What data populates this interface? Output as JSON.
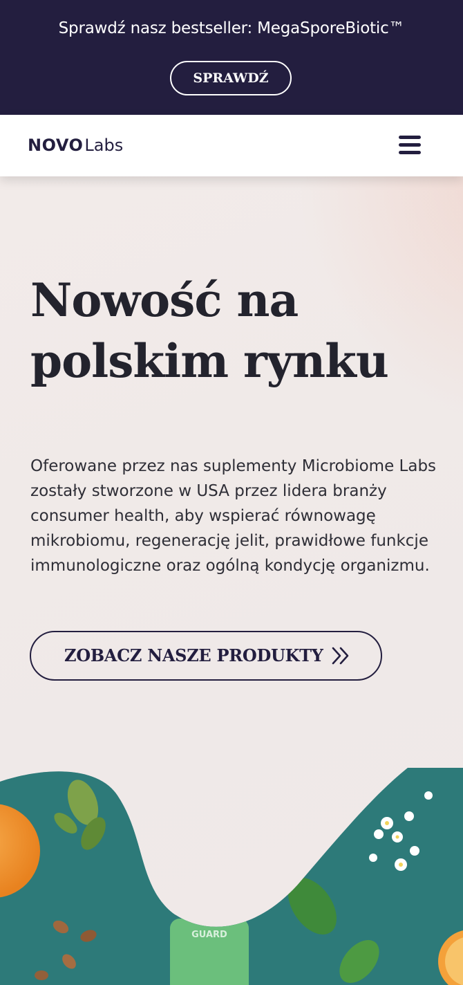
{
  "promo": {
    "text": "Sprawdź nasz bestseller: MegaSporeBiotic™",
    "button_label": "SPRAWDŹ"
  },
  "header": {
    "logo_bold": "NOVO",
    "logo_light": "Labs",
    "menu_icon": "hamburger-menu-icon"
  },
  "hero": {
    "headline": "Nowość na polskim rynku",
    "headline_line1": "Nowość na",
    "headline_line2": "polskim rynku",
    "description": "Oferowane przez nas suplementy Microbiome Labs zostały stworzone w USA przez lidera branży consumer health, aby wspierać równowagę mikrobiomu, regenerację jelit, prawidłowe funkcje immunologiczne oraz ogólną kondycję organizmu.",
    "cta_label": "ZOBACZ NASZE PRODUKTY",
    "cta_icon": "double-chevron-right-icon"
  },
  "bottle_label": "GUARD",
  "colors": {
    "brand_dark": "#231e3f",
    "hero_bg": "#efe9e8",
    "photo_bg": "#2f7d7c"
  }
}
